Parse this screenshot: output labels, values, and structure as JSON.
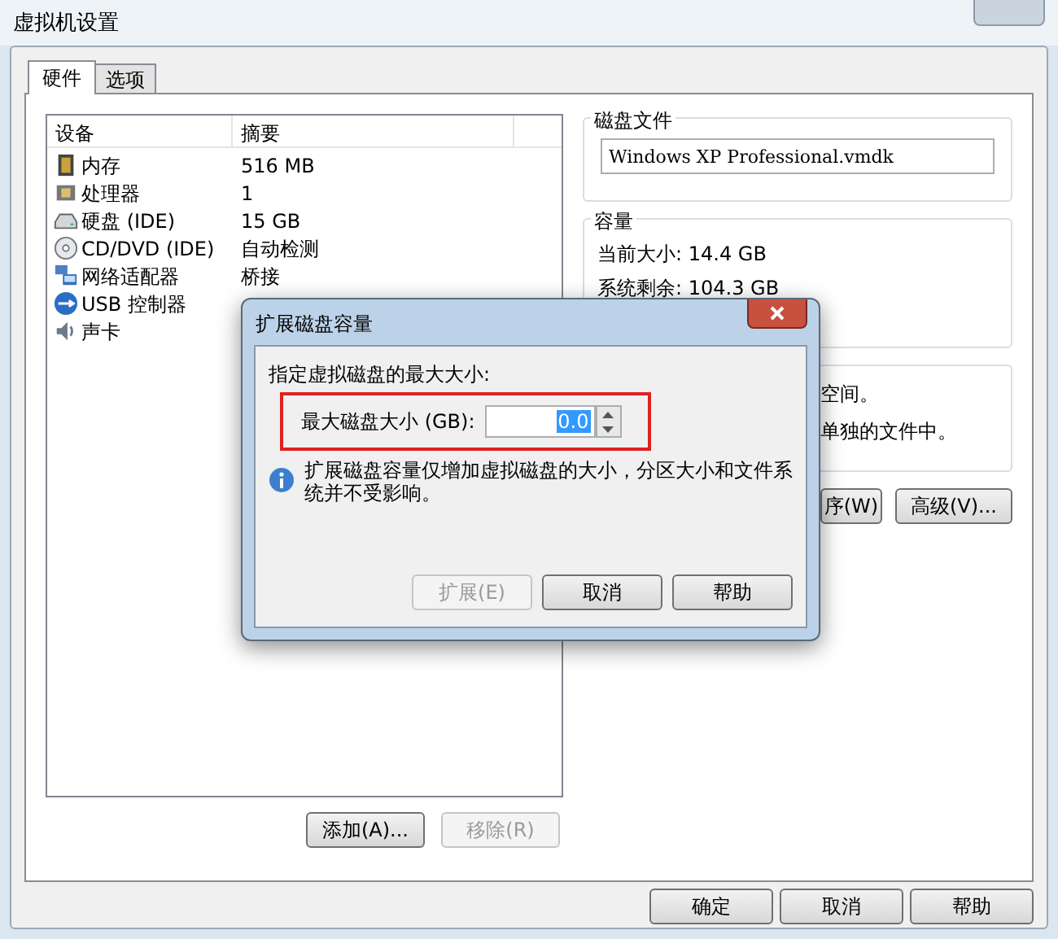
{
  "window": {
    "title": "虚拟机设置"
  },
  "tabs": [
    {
      "label": "硬件",
      "selected": true
    },
    {
      "label": "选项",
      "selected": false
    }
  ],
  "device_list": {
    "columns": [
      "设备",
      "摘要"
    ],
    "rows": [
      {
        "kind": "memory",
        "device": "内存",
        "summary": "516 MB"
      },
      {
        "kind": "cpu",
        "device": "处理器",
        "summary": "1"
      },
      {
        "kind": "disk",
        "device": "硬盘 (IDE)",
        "summary": "15 GB"
      },
      {
        "kind": "cdrom",
        "device": "CD/DVD (IDE)",
        "summary": "自动检测"
      },
      {
        "kind": "network",
        "device": "网络适配器",
        "summary": "桥接"
      },
      {
        "kind": "usb",
        "device": "USB 控制器"
      },
      {
        "kind": "sound",
        "device": "声卡"
      }
    ]
  },
  "list_buttons": [
    {
      "label": "添加(A)...",
      "disabled": false
    },
    {
      "label": "移除(R)",
      "disabled": true
    }
  ],
  "disk_file": {
    "title": "磁盘文件",
    "value": "Windows XP Professional.vmdk"
  },
  "capacity": {
    "title": "容量",
    "lines": [
      "当前大小: 14.4 GB",
      "系统剩余: 104.3 GB"
    ]
  },
  "third_group": {
    "lines": [
      "空间。",
      "单独的文件中。"
    ]
  },
  "side_buttons": [
    {
      "label": "序(W)",
      "disabled": false
    },
    {
      "label": "高级(V)...",
      "disabled": false
    }
  ],
  "footer_buttons": [
    {
      "label": "确定",
      "disabled": false
    },
    {
      "label": "取消",
      "disabled": false
    },
    {
      "label": "帮助",
      "disabled": false
    }
  ],
  "dialog": {
    "title": "扩展磁盘容量",
    "prompt": "指定虚拟磁盘的最大大小:",
    "field_label": "最大磁盘大小 (GB):",
    "value": "0.0",
    "info": "扩展磁盘容量仅增加虚拟磁盘的大小，分区大小和文件系统并不受影响。",
    "buttons": [
      {
        "label": "扩展(E)",
        "disabled": true
      },
      {
        "label": "取消",
        "disabled": false
      },
      {
        "label": "帮助",
        "disabled": false
      }
    ]
  }
}
